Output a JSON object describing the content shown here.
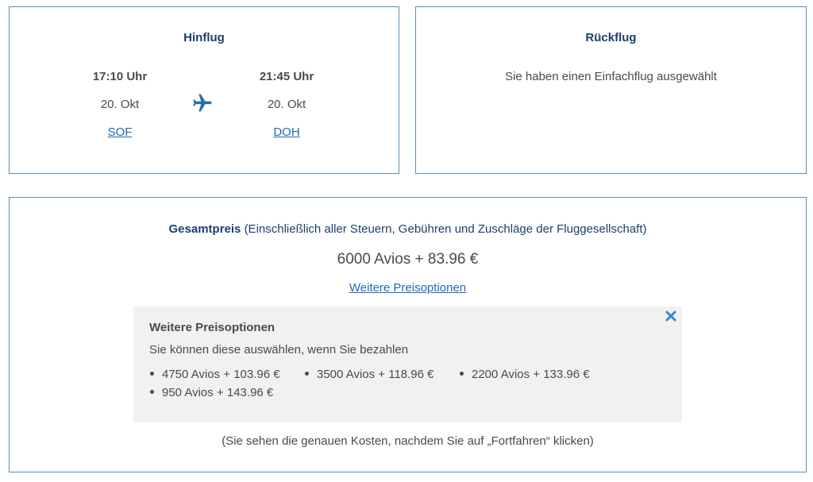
{
  "outbound": {
    "title": "Hinflug",
    "departure": {
      "time": "17:10 Uhr",
      "date": "20. Okt",
      "airport": "SOF"
    },
    "arrival": {
      "time": "21:45 Uhr",
      "date": "20. Okt",
      "airport": "DOH"
    },
    "icon": "airplane-icon"
  },
  "return": {
    "title": "Rückflug",
    "message": "Sie haben einen Einfachflug ausgewählt"
  },
  "price": {
    "label": "Gesamtpreis",
    "label_note": "(Einschließlich aller Steuern, Gebühren und Zuschläge der Fluggesellschaft)",
    "amount": "6000 Avios + 83.96 €",
    "more_options_link": "Weitere Preisoptionen",
    "options_panel": {
      "title": "Weitere Preisoptionen",
      "subtitle": "Sie können diese auswählen, wenn Sie bezahlen",
      "close_icon": "close-icon",
      "options": [
        "4750 Avios + 103.96 €",
        "3500 Avios + 118.96 €",
        "2200 Avios + 133.96 €",
        "950 Avios + 143.96 €"
      ]
    },
    "note": "(Sie sehen die genauen Kosten, nachdem Sie auf „Fortfahren“ klicken)"
  },
  "colors": {
    "border": "#5b8db8",
    "heading": "#1c3f6e",
    "link": "#1f6ab4",
    "panel_bg": "#f1f1f1"
  }
}
